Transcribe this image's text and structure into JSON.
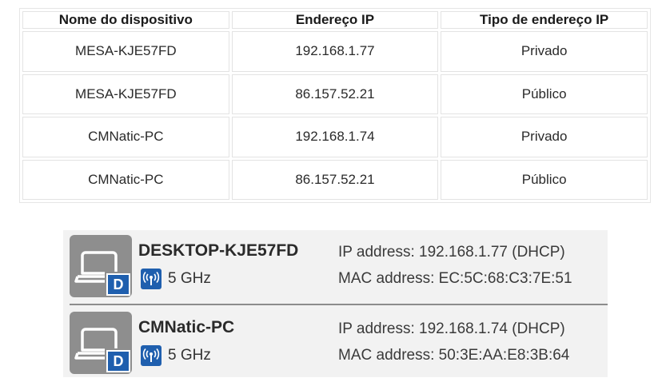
{
  "table": {
    "headers": [
      "Nome do dispositivo",
      "Endereço IP",
      "Tipo de endereço IP"
    ],
    "rows": [
      [
        "MESA-KJE57FD",
        "192.168.1.77",
        "Privado"
      ],
      [
        "MESA-KJE57FD",
        "86.157.52.21",
        "Público"
      ],
      [
        "CMNatic-PC",
        "192.168.1.74",
        "Privado"
      ],
      [
        "CMNatic-PC",
        "86.157.52.21",
        "Público"
      ]
    ]
  },
  "devices": [
    {
      "name": "DESKTOP-KJE57FD",
      "badge": "D",
      "band": "5 GHz",
      "ip": "IP address: 192.168.1.77 (DHCP)",
      "mac": "MAC address: EC:5C:68:C3:7E:51",
      "icon": "laptop-icon",
      "band_icon": "wifi-antenna-icon"
    },
    {
      "name": "CMNatic-PC",
      "badge": "D",
      "band": "5 GHz",
      "ip": "IP address: 192.168.1.74 (DHCP)",
      "mac": "MAC address: 50:3E:AA:E8:3B:64",
      "icon": "laptop-icon",
      "band_icon": "wifi-antenna-icon"
    }
  ],
  "colors": {
    "badge_blue": "#1f5fae",
    "icon_gray": "#8e8e8e",
    "panel_bg": "#f2f2f2"
  }
}
